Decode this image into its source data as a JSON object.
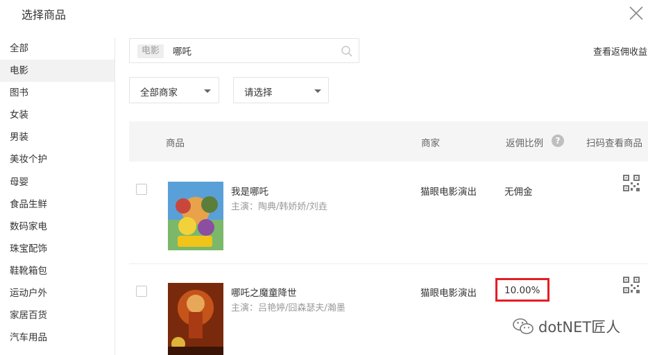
{
  "dialog": {
    "title": "选择商品"
  },
  "sidebar": {
    "items": [
      {
        "label": "全部"
      },
      {
        "label": "电影"
      },
      {
        "label": "图书"
      },
      {
        "label": "女装"
      },
      {
        "label": "男装"
      },
      {
        "label": "美妆个护"
      },
      {
        "label": "母婴"
      },
      {
        "label": "食品生鲜"
      },
      {
        "label": "数码家电"
      },
      {
        "label": "珠宝配饰"
      },
      {
        "label": "鞋靴箱包"
      },
      {
        "label": "运动户外"
      },
      {
        "label": "家居百货"
      },
      {
        "label": "汽车用品"
      }
    ],
    "active_label": "电影"
  },
  "search": {
    "category_tag": "电影",
    "value": "哪吒"
  },
  "commission_link": "查看返佣收益",
  "filters": {
    "merchant_select": "全部商家",
    "other_select": "请选择"
  },
  "table": {
    "headers": {
      "product": "商品",
      "merchant": "商家",
      "commission_rate": "返佣比例",
      "help": "?",
      "scan": "扫码查看商品"
    },
    "rows": [
      {
        "title": "我是哪吒",
        "cast": "主演：陶典/韩娇娇/刘垚",
        "merchant": "猫眼电影演出",
        "commission": "无佣金",
        "highlighted": false
      },
      {
        "title": "哪吒之魔童降世",
        "cast": "主演：吕艳婷/囧森瑟夫/瀚墨",
        "merchant": "猫眼电影演出",
        "commission": "10.00%",
        "highlighted": true
      }
    ]
  },
  "watermark": {
    "text": "dotNET匠人"
  },
  "colors": {
    "highlight_border": "#e51c23",
    "header_bg": "#f5f5f5",
    "active_bg": "#f2f2f2"
  }
}
